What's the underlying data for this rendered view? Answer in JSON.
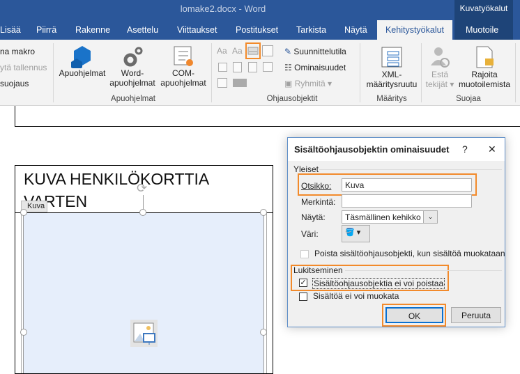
{
  "window": {
    "title": "lomake2.docx  -  Word",
    "context_tab_group": "Kuvatyökalut"
  },
  "tabs": [
    {
      "label": "Lisää"
    },
    {
      "label": "Piirrä"
    },
    {
      "label": "Rakenne"
    },
    {
      "label": "Asettelu"
    },
    {
      "label": "Viittaukset"
    },
    {
      "label": "Postitukset"
    },
    {
      "label": "Tarkista"
    },
    {
      "label": "Näytä"
    },
    {
      "label": "Kehitystyökalut",
      "active": true
    },
    {
      "label": "Muotoile"
    }
  ],
  "ribbon": {
    "koodi": {
      "items": [
        "na makro",
        "ytä tallennus",
        "suojaus"
      ]
    },
    "apuohjelmat": {
      "label": "Apuohjelmat",
      "apuohjelmat": "Apuohjelmat",
      "word_line1": "Word-",
      "word_line2": "apuohjelmat",
      "com_line1": "COM-",
      "com_line2": "apuohjelmat"
    },
    "ohjausobjektit": {
      "label": "Ohjausobjektit",
      "suunnittelutila": "Suunnittelutila",
      "ominaisuudet": "Ominaisuudet",
      "ryhmita": "Ryhmitä",
      "aa1": "Aa",
      "aa2": "Aa"
    },
    "maaritys": {
      "label": "Määritys",
      "xml_line1": "XML-",
      "xml_line2": "määritysruutu"
    },
    "suojaa": {
      "label": "Suojaa",
      "esta_line1": "Estä",
      "esta_line2": "tekijät",
      "rajoita_line1": "Rajoita",
      "rajoita_line2": "muotoilemista"
    }
  },
  "document": {
    "heading": "KUVA HENKILÖKORTTIA VARTEN",
    "control_tag": "Kuva"
  },
  "dialog": {
    "title": "Sisältöohjausobjektin ominaisuudet",
    "help": "?",
    "close": "✕",
    "general_legend": "Yleiset",
    "title_label": "Otsikko:",
    "title_value": "Kuva",
    "tag_label": "Merkintä:",
    "tag_value": "",
    "show_label": "Näytä:",
    "show_value": "Täsmällinen kehikko",
    "color_label": "Väri:",
    "remove_when_edited": "Poista sisältöohjausobjekti, kun sisältöä muokataan",
    "remove_when_edited_checked": false,
    "locking_legend": "Lukitseminen",
    "cannot_delete": "Sisältöohjausobjektia ei voi poistaa",
    "cannot_delete_checked": true,
    "cannot_edit": "Sisältöä ei voi muokata",
    "cannot_edit_checked": false,
    "ok": "OK",
    "cancel": "Peruuta"
  },
  "colors": {
    "brand": "#2b579a",
    "highlight": "#f28a2b",
    "control_fill": "#e6eefb"
  }
}
